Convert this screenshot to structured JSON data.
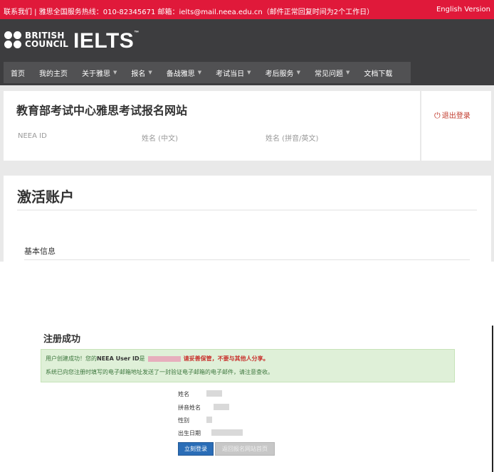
{
  "topbar": {
    "info": "联系我们 | 雅思全国服务热线：010-82345671   邮箱：ielts@mail.neea.edu.cn（邮件正常回复时间为2个工作日）",
    "lang": "English Version"
  },
  "logo": {
    "bc_line1": "BRITISH",
    "bc_line2": "COUNCIL",
    "ielts": "IELTS",
    "tm": "™"
  },
  "nav": [
    {
      "label": "首页",
      "dropdown": false
    },
    {
      "label": "我的主页",
      "dropdown": false
    },
    {
      "label": "关于雅思",
      "dropdown": true
    },
    {
      "label": "报名",
      "dropdown": true
    },
    {
      "label": "备战雅思",
      "dropdown": true
    },
    {
      "label": "考试当日",
      "dropdown": true
    },
    {
      "label": "考后服务",
      "dropdown": true
    },
    {
      "label": "常见问题",
      "dropdown": true
    },
    {
      "label": "文档下载",
      "dropdown": false
    }
  ],
  "site_card": {
    "title": "教育部考试中心雅思考试报名网站",
    "fields": [
      "NEEA ID",
      "姓名 (中文)",
      "姓名 (拼音/英文)"
    ],
    "logout": "退出登录"
  },
  "activate": {
    "title": "激活账户",
    "section": "基本信息"
  },
  "registration": {
    "title": "注册成功",
    "alert_prefix": "用户创建成功！您的",
    "alert_id_label": "NEEA User ID",
    "alert_id_suffix": "是",
    "alert_warning": "请妥善保管，不要与其他人分享。",
    "alert_line2": "系统已向您注册时填写的电子邮箱地址发送了一封验证电子邮箱的电子邮件，请注意查收。",
    "labels": [
      "姓名",
      "拼音姓名",
      "性别",
      "出生日期"
    ],
    "btn_login": "立刻登录",
    "btn_back": "返回报名网站首页"
  },
  "colors": {
    "topbar": "#e0193a",
    "header": "#3d3d3f",
    "nav": "#515153",
    "alert_bg": "#dff0d8",
    "login_button": "#2a6db7"
  }
}
